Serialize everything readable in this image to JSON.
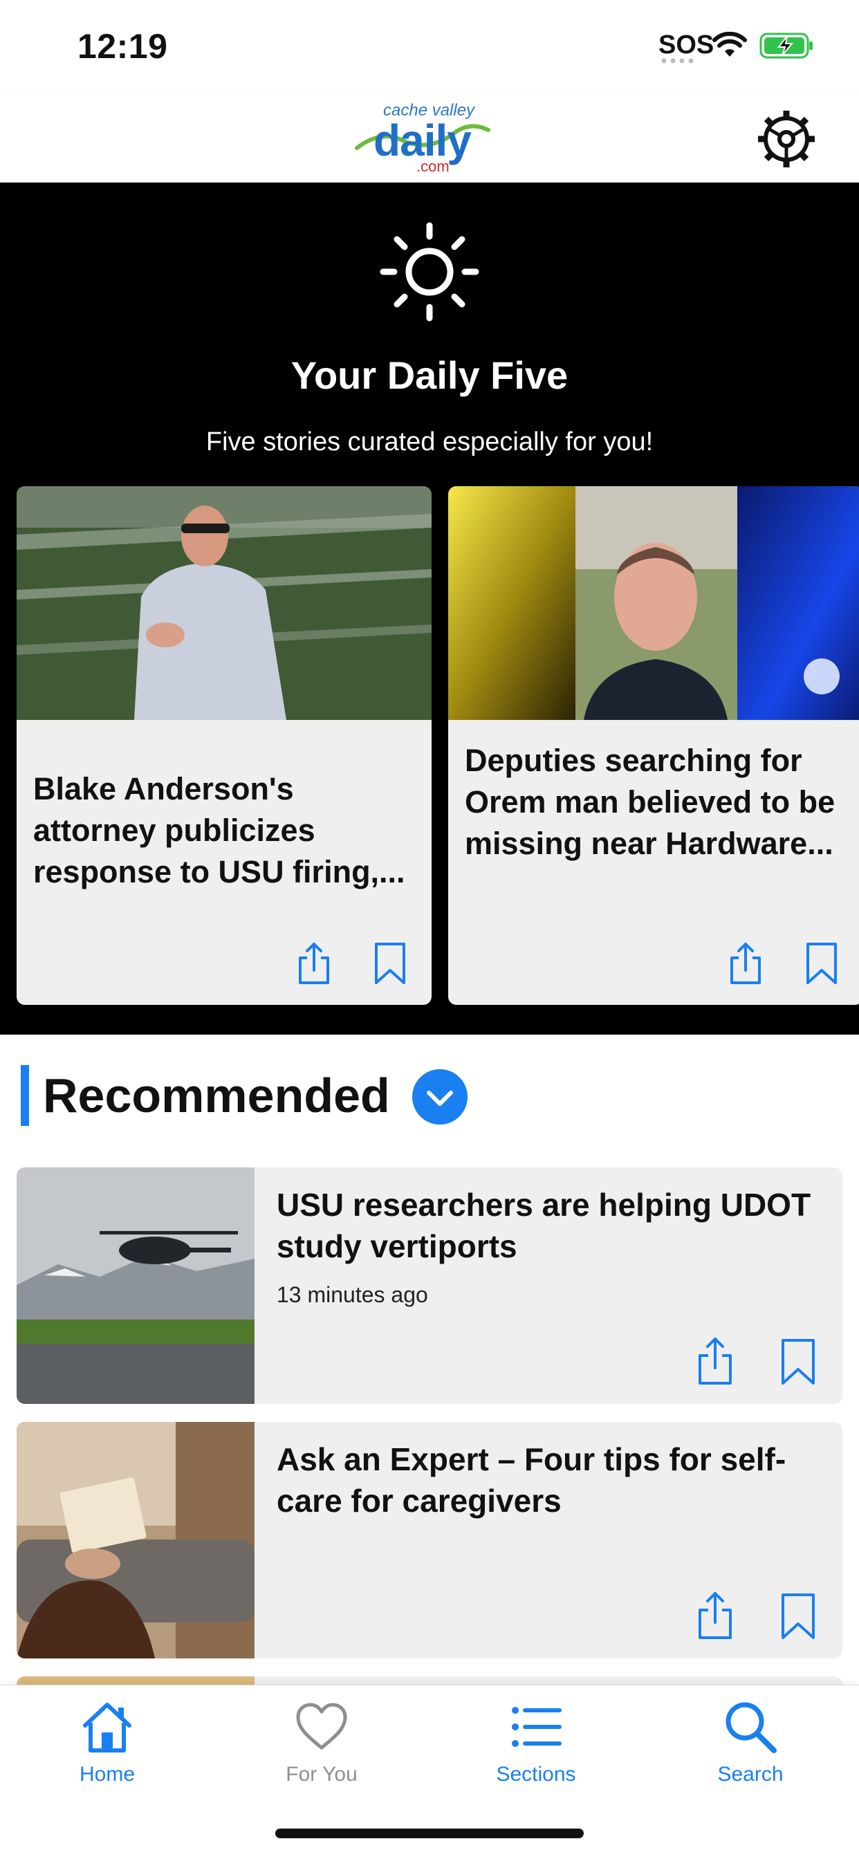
{
  "status_bar": {
    "time": "12:19",
    "carrier": "SOS",
    "battery_state": "charging"
  },
  "header": {
    "logo_top": "cache valley",
    "logo_main": "daily",
    "logo_bottom": ".com",
    "settings_icon": "gear-icon"
  },
  "daily_five": {
    "icon": "sun-icon",
    "title": "Your Daily Five",
    "subtitle": "Five stories curated especially for you!",
    "cards": [
      {
        "title": "Blake Anderson's attorney publicizes response to USU firing,...",
        "image": "coach-on-field"
      },
      {
        "title": "Deputies searching for Orem man believed to be missing near Hardware...",
        "image": "man-portrait-police-lights"
      }
    ]
  },
  "recommended": {
    "title": "Recommended",
    "items": [
      {
        "title": "USU researchers are helping UDOT study vertiports",
        "time": "13 minutes ago",
        "image": "helicopter-mountains"
      },
      {
        "title": "Ask an Expert – Four tips for self-care for caregivers",
        "time": "",
        "image": "woman-reading-couch"
      }
    ]
  },
  "tabs": [
    {
      "label": "Home",
      "icon": "home-icon",
      "active": true
    },
    {
      "label": "For You",
      "icon": "heart-icon",
      "active": false
    },
    {
      "label": "Sections",
      "icon": "list-icon",
      "active": false
    },
    {
      "label": "Search",
      "icon": "search-icon",
      "active": false
    }
  ],
  "colors": {
    "accent": "#1a7ff0",
    "inactive": "#8e8e93",
    "card_bg": "#efefef",
    "hero_bg": "#000000"
  }
}
